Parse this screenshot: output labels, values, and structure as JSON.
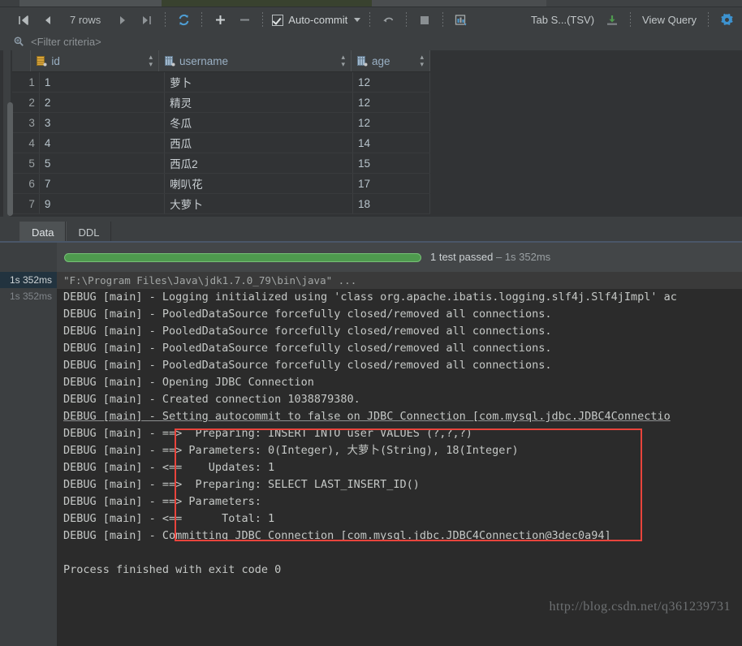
{
  "toolbar": {
    "first_page_icon": "skip-to-first-icon",
    "prev_page_icon": "previous-page-icon",
    "row_count": "7 rows",
    "next_page_icon": "next-page-icon",
    "last_page_icon": "skip-to-last-icon",
    "reload_icon": "reload-icon",
    "add_row_icon": "plus-icon",
    "remove_row_icon": "minus-icon",
    "auto_commit_label": "Auto-commit",
    "auto_commit_checked": true,
    "auto_commit_dropdown_icon": "chevron-down-icon",
    "rollback_icon": "undo-arrow-icon",
    "stop_icon": "stop-square-icon",
    "db_transfer_icon": "database-export-icon",
    "output_format": "Tab S...(TSV)",
    "export_icon": "download-icon",
    "view_query_label": "View Query",
    "settings_icon": "gear-icon"
  },
  "filter": {
    "icon": "filter-search-icon",
    "placeholder": "<Filter criteria>",
    "value": ""
  },
  "grid": {
    "columns": [
      {
        "label": "id",
        "icon": "primary-key-icon",
        "sort_icon": "sort-toggle-icon"
      },
      {
        "label": "username",
        "icon": "table-column-icon",
        "sort_icon": "sort-toggle-icon"
      },
      {
        "label": "age",
        "icon": "table-column-icon",
        "sort_icon": "sort-toggle-icon"
      }
    ],
    "rows": [
      {
        "num": "1",
        "id": "1",
        "username": "萝卜",
        "age": "12"
      },
      {
        "num": "2",
        "id": "2",
        "username": "精灵",
        "age": "12"
      },
      {
        "num": "3",
        "id": "3",
        "username": "冬瓜",
        "age": "12"
      },
      {
        "num": "4",
        "id": "4",
        "username": "西瓜",
        "age": "14"
      },
      {
        "num": "5",
        "id": "5",
        "username": "西瓜2",
        "age": "15"
      },
      {
        "num": "6",
        "id": "7",
        "username": "喇叭花",
        "age": "17"
      },
      {
        "num": "7",
        "id": "9",
        "username": "大萝卜",
        "age": "18"
      }
    ],
    "highlight_row_index": 6,
    "highlight_color": "#e8443c"
  },
  "tabs": [
    {
      "label": "Data",
      "active": true
    },
    {
      "label": "DDL",
      "active": false
    }
  ],
  "test_run": {
    "progress_percent": 100,
    "progress_color": "#4e9a4e",
    "status": "1 test passed",
    "duration": "– 1s 352ms",
    "gutter": [
      {
        "time": "1s 352ms",
        "selected": true
      },
      {
        "time": "1s 352ms",
        "selected": false
      }
    ]
  },
  "console": {
    "lines": [
      {
        "text": "\"F:\\Program Files\\Java\\jdk1.7.0_79\\bin\\java\" ...",
        "style": "cmd"
      },
      {
        "text": "DEBUG [main] - Logging initialized using 'class org.apache.ibatis.logging.slf4j.Slf4jImpl' ac",
        "style": "plain"
      },
      {
        "text": "DEBUG [main] - PooledDataSource forcefully closed/removed all connections.",
        "style": "plain"
      },
      {
        "text": "DEBUG [main] - PooledDataSource forcefully closed/removed all connections.",
        "style": "plain"
      },
      {
        "text": "DEBUG [main] - PooledDataSource forcefully closed/removed all connections.",
        "style": "plain"
      },
      {
        "text": "DEBUG [main] - PooledDataSource forcefully closed/removed all connections.",
        "style": "plain"
      },
      {
        "text": "DEBUG [main] - Opening JDBC Connection",
        "style": "plain"
      },
      {
        "text": "DEBUG [main] - Created connection 1038879380.",
        "style": "plain"
      },
      {
        "text": "DEBUG [main] - Setting autocommit to false on JDBC Connection [com.mysql.jdbc.JDBC4Connectio",
        "style": "link"
      },
      {
        "text": "DEBUG [main] - ==>  Preparing: INSERT INTO user VALUES (?,?,?)",
        "style": "plain"
      },
      {
        "text": "DEBUG [main] - ==> Parameters: 0(Integer), 大萝卜(String), 18(Integer)",
        "style": "plain"
      },
      {
        "text": "DEBUG [main] - <==    Updates: 1",
        "style": "plain"
      },
      {
        "text": "DEBUG [main] - ==>  Preparing: SELECT LAST_INSERT_ID()",
        "style": "plain"
      },
      {
        "text": "DEBUG [main] - ==> Parameters:",
        "style": "plain"
      },
      {
        "text": "DEBUG [main] - <==      Total: 1",
        "style": "plain"
      },
      {
        "text": "DEBUG [main] - Committing JDBC Connection [com.mysql.jdbc.JDBC4Connection@3dec0a94]",
        "style": "plain"
      },
      {
        "text": "",
        "style": "plain"
      },
      {
        "text": "Process finished with exit code 0",
        "style": "plain"
      }
    ],
    "highlight_box_color": "#e8443c",
    "watermark": "http://blog.csdn.net/q361239731"
  }
}
